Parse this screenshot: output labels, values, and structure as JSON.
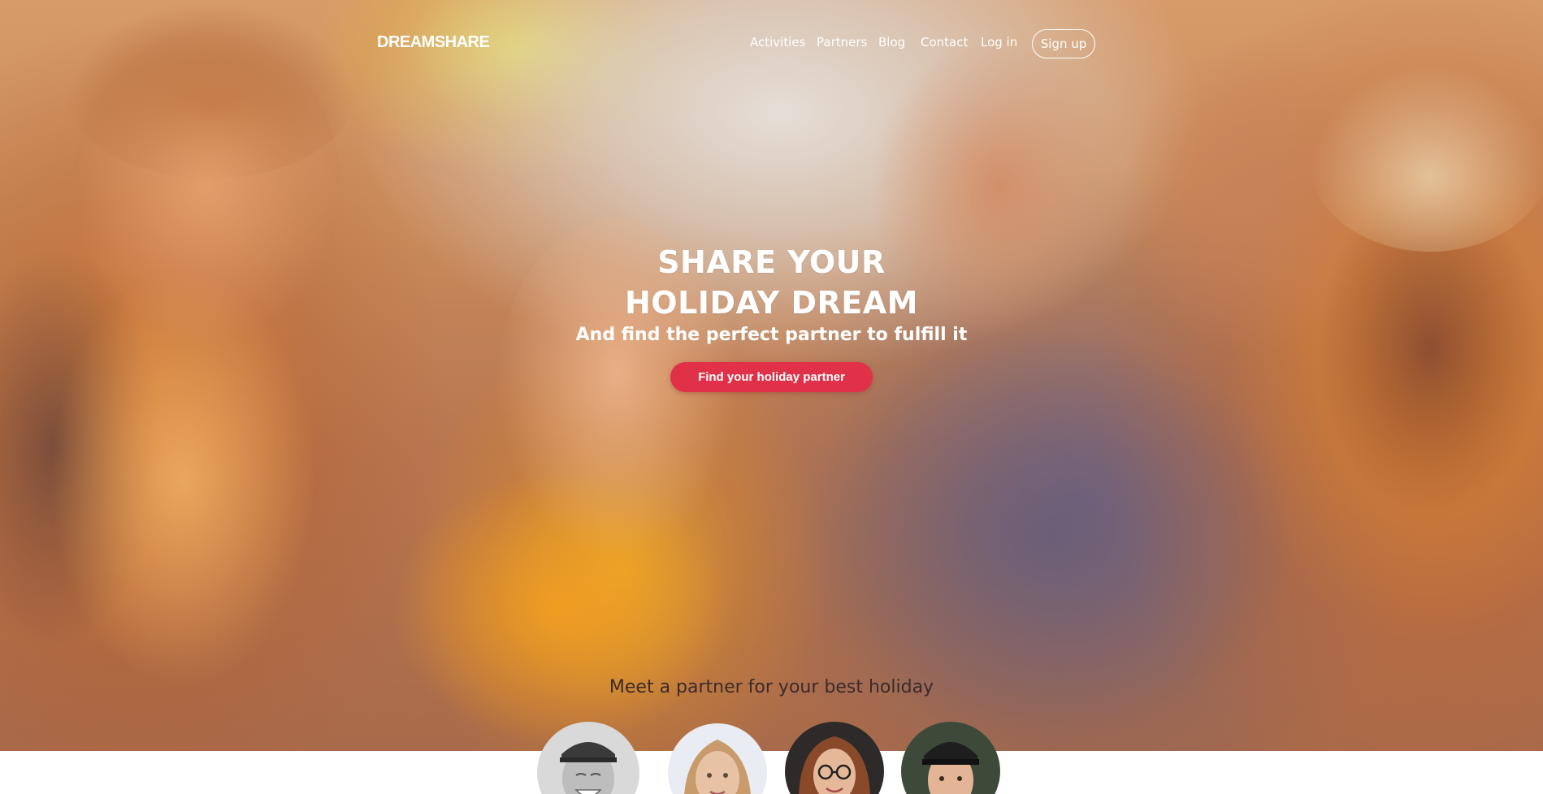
{
  "brand": {
    "logo_text": "DREAMSHARE"
  },
  "nav": {
    "items": [
      {
        "label": "Activities"
      },
      {
        "label": "Partners"
      },
      {
        "label": "Blog"
      },
      {
        "label": "Contact"
      },
      {
        "label": "Log in"
      }
    ],
    "signup_label": "Sign up"
  },
  "hero": {
    "headline_line1": "SHARE YOUR",
    "headline_line2": "HOLIDAY DREAM",
    "subheadline": "And find the perfect partner to fulfill it",
    "cta_label": "Find your holiday partner",
    "background_image": "group-of-friends-laughing-photo"
  },
  "partners": {
    "title": "Meet a partner for your best holiday",
    "avatars": [
      {
        "icon": "avatar-man-cap-laughing"
      },
      {
        "icon": "avatar-woman-blonde"
      },
      {
        "icon": "avatar-woman-glasses"
      },
      {
        "icon": "avatar-man-cap"
      }
    ]
  },
  "colors": {
    "accent": "#e03148",
    "text_light": "#ffffff",
    "text_dark": "#3a2b2c"
  }
}
